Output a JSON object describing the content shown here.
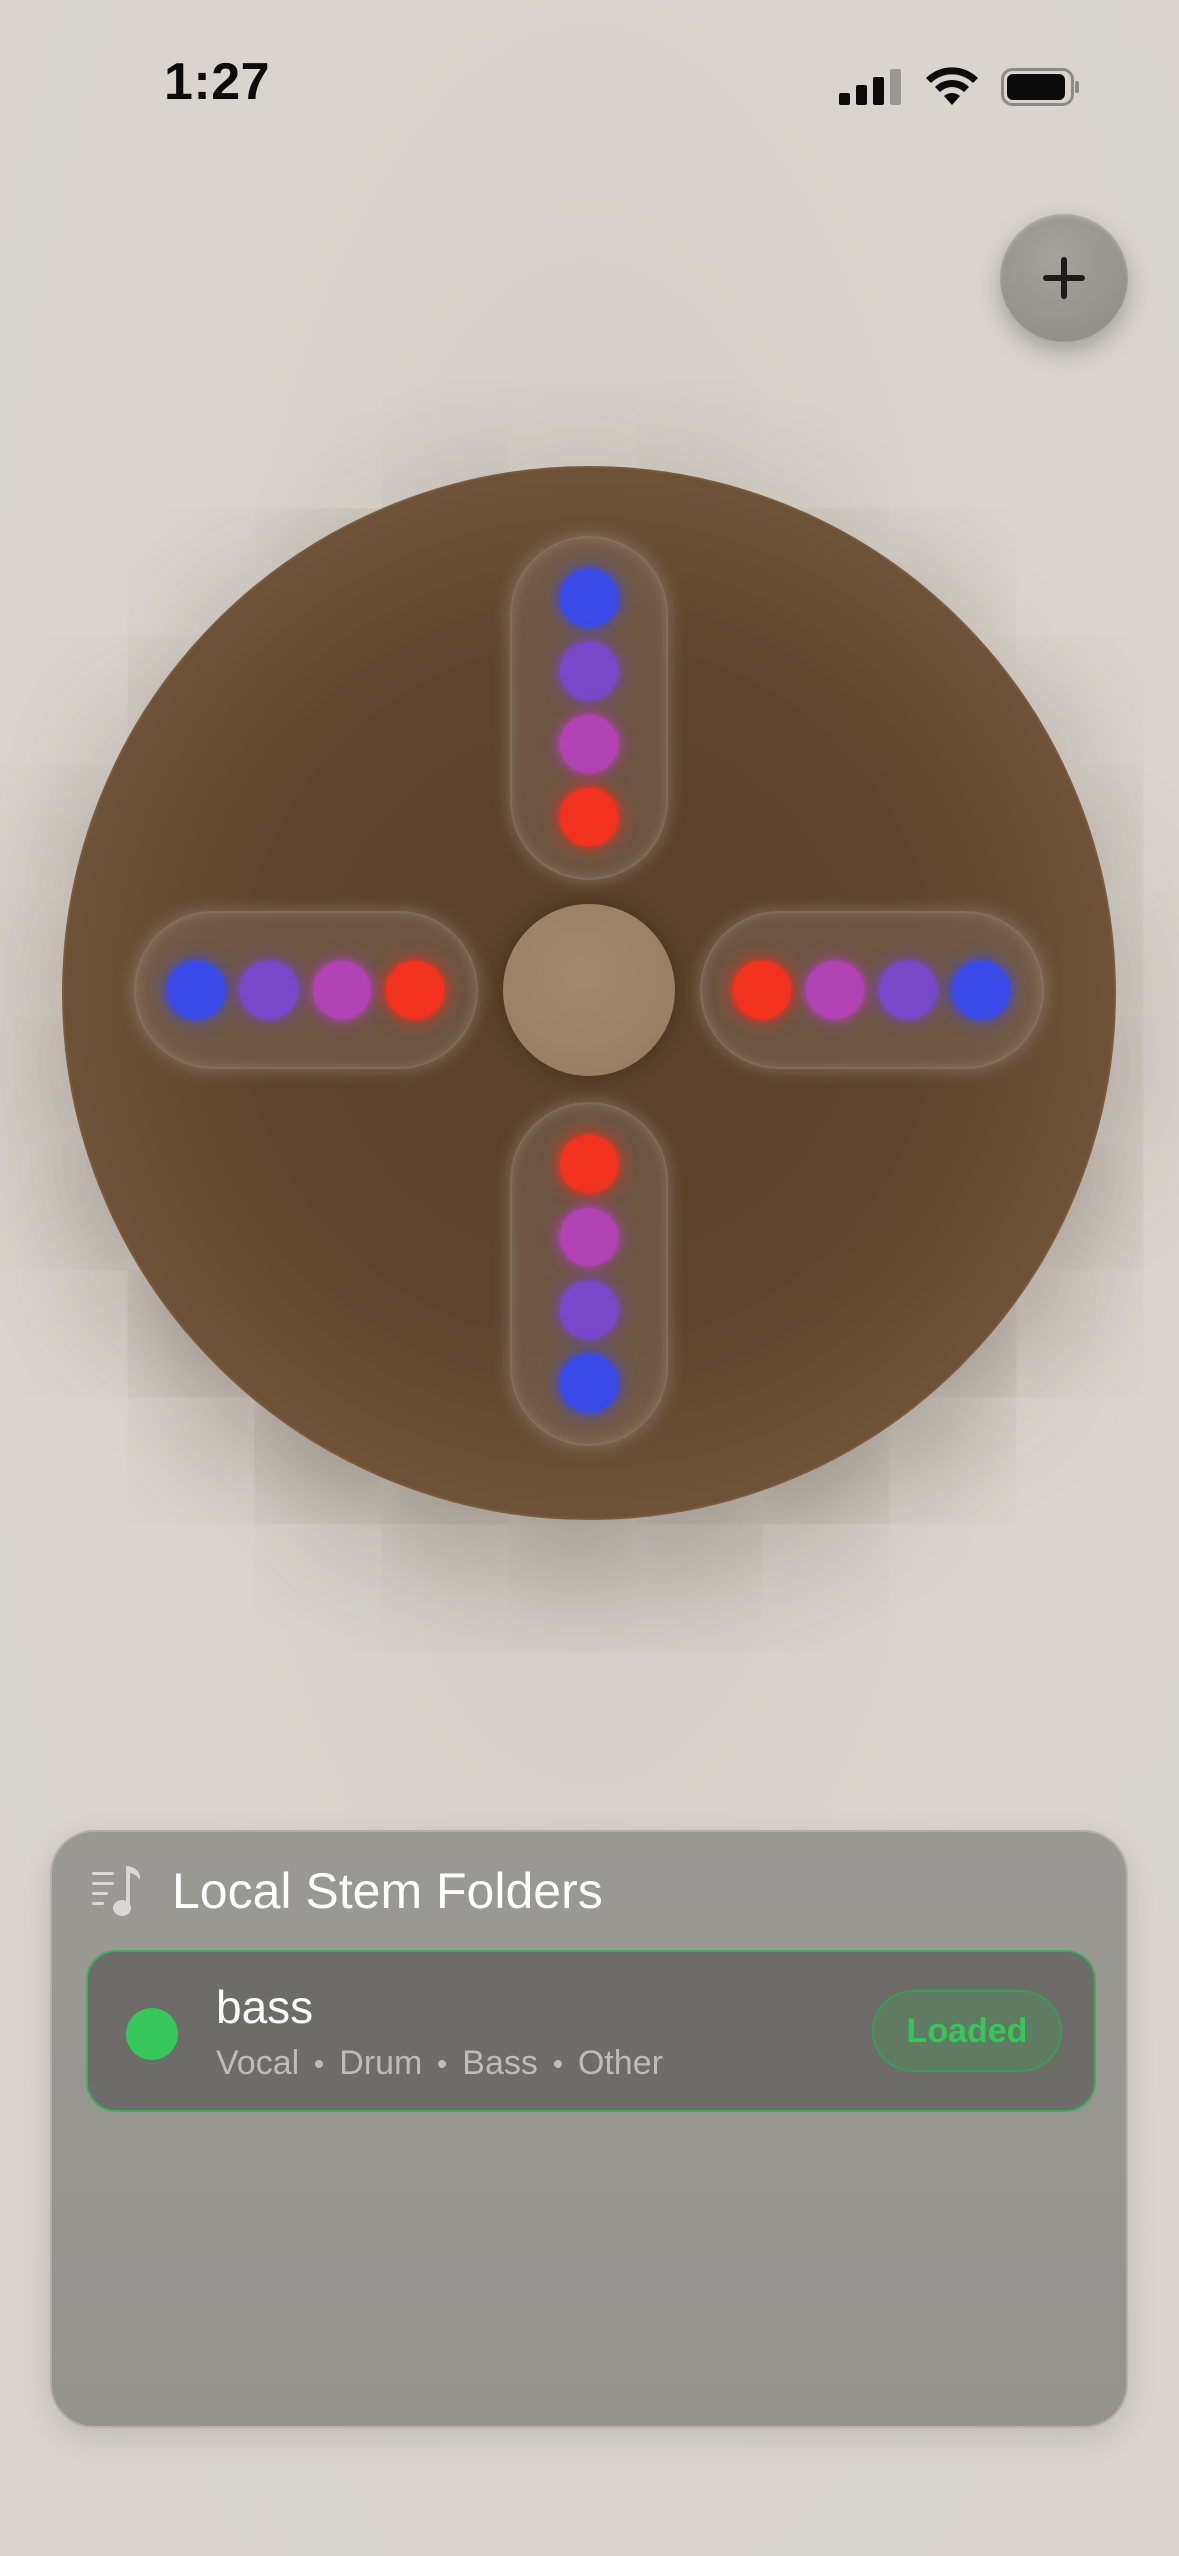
{
  "status_bar": {
    "time": "1:27"
  },
  "toolbar": {
    "add_icon": "plus-icon"
  },
  "wheel": {
    "arms": {
      "top": [
        "#3a4ae8",
        "#7848c9",
        "#b143b5",
        "#f0321f"
      ],
      "left": [
        "#3a4ae8",
        "#7848c9",
        "#b143b5",
        "#f0321f"
      ],
      "right": [
        "#f0321f",
        "#b143b5",
        "#7848c9",
        "#3a4ae8"
      ],
      "bottom": [
        "#f0321f",
        "#b143b5",
        "#7848c9",
        "#3a4ae8"
      ]
    }
  },
  "panel": {
    "title": "Local Stem Folders",
    "icon": "music-list-icon",
    "folders": [
      {
        "name": "bass",
        "stems": [
          "Vocal",
          "Drum",
          "Bass",
          "Other"
        ],
        "badge": "Loaded",
        "status_color": "#35c759"
      }
    ]
  }
}
